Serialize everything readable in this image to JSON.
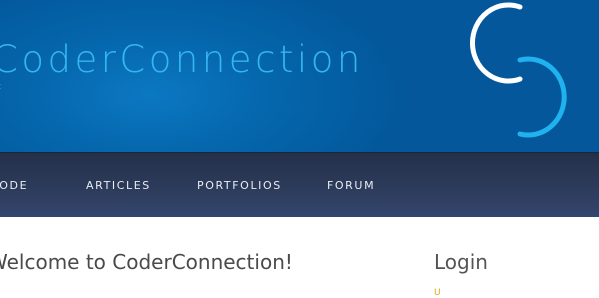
{
  "header": {
    "site_title": "CoderConnection",
    "tagline": "t",
    "logo_name": "cc-logo-icon",
    "colors": {
      "background": "#0567ad",
      "title": "#35b6ef",
      "logo_white": "#ffffff",
      "logo_blue": "#1fb2ee"
    }
  },
  "nav": {
    "items": [
      {
        "label": "CODE"
      },
      {
        "label": "ARTICLES"
      },
      {
        "label": "PORTFOLIOS"
      },
      {
        "label": "FORUM"
      }
    ],
    "colors": {
      "background": "#2d3b5b",
      "text": "#e9edf3"
    }
  },
  "main": {
    "welcome_heading": "Welcome to CoderConnection!"
  },
  "sidebar": {
    "login_title": "Login",
    "login_link": "U"
  }
}
